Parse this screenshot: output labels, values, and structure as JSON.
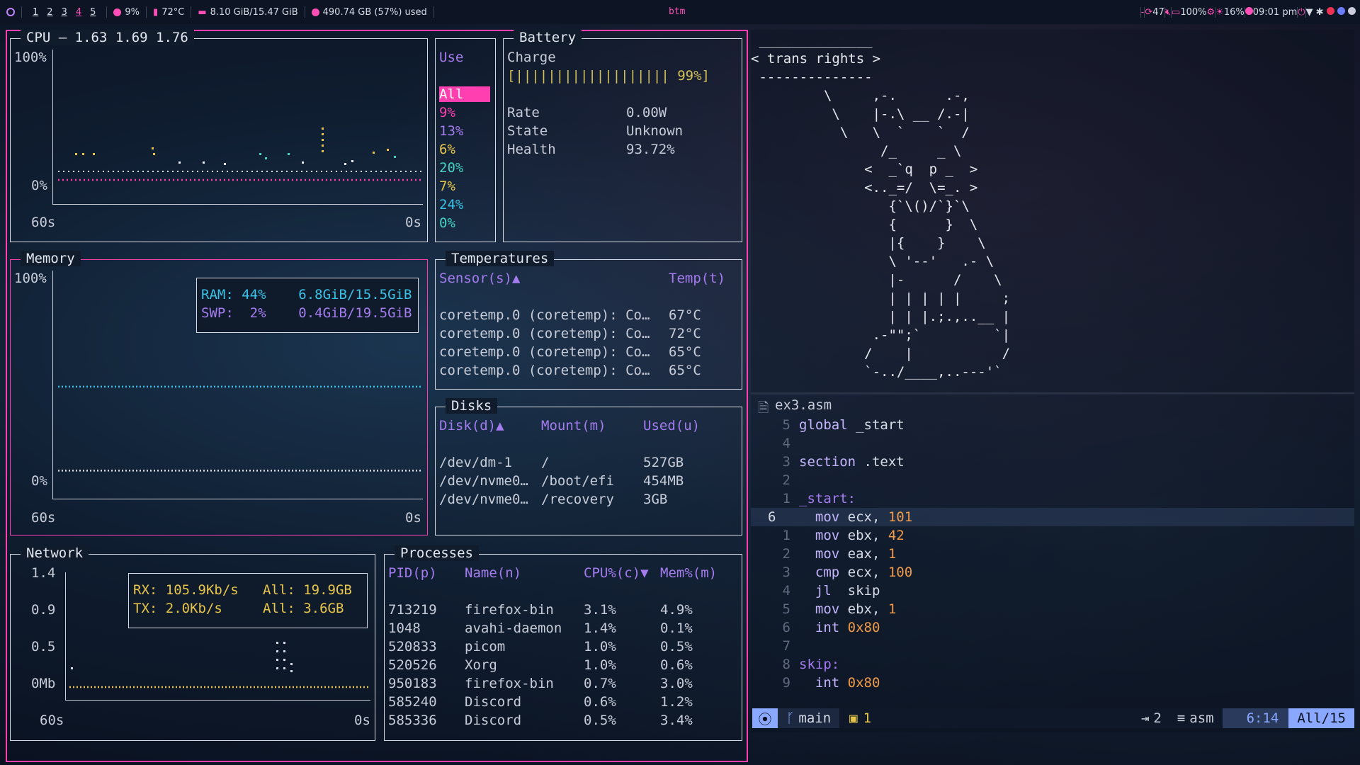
{
  "topbar": {
    "workspaces": [
      "1",
      "2",
      "3",
      "4",
      "5"
    ],
    "active_workspace": "4",
    "cpu": "9%",
    "temp": "72°C",
    "memory": "8.10 GiB/15.47 GiB",
    "disk": "490.74 GB (57%) used",
    "title": "btm",
    "dash": "-",
    "updates": "47",
    "volume": "100%",
    "brightness": "16%",
    "clock": "09:01 pm"
  },
  "cpu": {
    "title": "CPU — 1.63 1.69 1.76",
    "y_max": "100%",
    "y_min": "0%",
    "x_left": "60s",
    "x_right": "0s",
    "use_header": "Use",
    "entries": [
      "All",
      "9%",
      "13%",
      "6%",
      "20%",
      "7%",
      "24%",
      "0%"
    ]
  },
  "battery": {
    "title": "Battery",
    "charge_label": "Charge",
    "bar": "[||||||||||||||||||| 99%]",
    "rate_label": "Rate",
    "rate": "0.00W",
    "state_label": "State",
    "state": "Unknown",
    "health_label": "Health",
    "health": "93.72%"
  },
  "memory": {
    "title": "Memory",
    "y_max": "100%",
    "y_min": "0%",
    "x_left": "60s",
    "x_right": "0s",
    "ram": "RAM: 44%    6.8GiB/15.5GiB",
    "swp": "SWP:  2%    0.4GiB/19.5GiB",
    "ram_fraction": 0.44,
    "swp_fraction": 0.02
  },
  "temperatures": {
    "title": "Temperatures",
    "col_sensor": "Sensor(s)▲",
    "col_temp": "Temp(t)",
    "rows": [
      {
        "sensor": "coretemp.0 (coretemp): Co…",
        "temp": "67°C"
      },
      {
        "sensor": "coretemp.0 (coretemp): Co…",
        "temp": "72°C"
      },
      {
        "sensor": "coretemp.0 (coretemp): Co…",
        "temp": "65°C"
      },
      {
        "sensor": "coretemp.0 (coretemp): Co…",
        "temp": "65°C"
      }
    ]
  },
  "disks": {
    "title": "Disks",
    "col_disk": "Disk(d)▲",
    "col_mount": "Mount(m)",
    "col_used": "Used(u)",
    "rows": [
      {
        "disk": "/dev/dm-1",
        "mount": "/",
        "used": "527GB"
      },
      {
        "disk": "/dev/nvme0…",
        "mount": "/boot/efi",
        "used": "454MB"
      },
      {
        "disk": "/dev/nvme0…",
        "mount": "/recovery",
        "used": "3GB"
      }
    ]
  },
  "network": {
    "title": "Network",
    "y_ticks": [
      "1.4",
      "0.9",
      "0.5",
      "0Mb"
    ],
    "x_left": "60s",
    "x_right": "0s",
    "rx": "RX: 105.9Kb/s   All: 19.9GB",
    "tx": "TX: 2.0Kb/s     All: 3.6GB"
  },
  "processes": {
    "title": "Processes",
    "cols": [
      "PID(p)",
      "Name(n)",
      "CPU%(c)▼",
      "Mem%(m)"
    ],
    "rows": [
      {
        "pid": "713219",
        "name": "firefox-bin",
        "cpu": "3.1%",
        "mem": "4.9%"
      },
      {
        "pid": "1048",
        "name": "avahi-daemon",
        "cpu": "1.4%",
        "mem": "0.1%"
      },
      {
        "pid": "520833",
        "name": "picom",
        "cpu": "1.0%",
        "mem": "0.5%"
      },
      {
        "pid": "520526",
        "name": "Xorg",
        "cpu": "1.0%",
        "mem": "0.6%"
      },
      {
        "pid": "950183",
        "name": "firefox-bin",
        "cpu": "0.7%",
        "mem": "3.0%"
      },
      {
        "pid": "585240",
        "name": "Discord",
        "cpu": "0.6%",
        "mem": "1.2%"
      },
      {
        "pid": "585336",
        "name": "Discord",
        "cpu": "0.5%",
        "mem": "3.4%"
      }
    ]
  },
  "cowsay": {
    "lines": [
      " ______________",
      "< trans rights >",
      " --------------",
      "         \\     ,-.      .-,",
      "          \\    |-.\\ __ /.-|",
      "           \\   \\  `    `  /",
      "                /_     _ \\",
      "              <  _`q  p _  >",
      "              <.._=/  \\=_. >",
      "                 {`\\()/`}`\\",
      "                 {      }  \\",
      "                 |{    }    \\",
      "                 \\ '--'   .- \\",
      "                 |-      /    \\",
      "                 | | | | |     ;",
      "                 | | |.;.,..__ |",
      "               .-\"\";`         `|",
      "              /    |           /",
      "              `-../____,..---'`"
    ]
  },
  "editor": {
    "filename": "ex3.asm",
    "lines": [
      {
        "n": "5",
        "code": "global _start",
        "cur": false
      },
      {
        "n": "4",
        "code": "",
        "cur": false
      },
      {
        "n": "3",
        "code": "section .text",
        "cur": false
      },
      {
        "n": "2",
        "code": "",
        "cur": false
      },
      {
        "n": "1",
        "code": "_start:",
        "cur": false
      },
      {
        "n": "6",
        "code": "  mov ecx, 101",
        "cur": true
      },
      {
        "n": "1",
        "code": "  mov ebx, 42",
        "cur": false
      },
      {
        "n": "2",
        "code": "  mov eax, 1",
        "cur": false
      },
      {
        "n": "3",
        "code": "  cmp ecx, 100",
        "cur": false
      },
      {
        "n": "4",
        "code": "  jl  skip",
        "cur": false
      },
      {
        "n": "5",
        "code": "  mov ebx, 1",
        "cur": false
      },
      {
        "n": "6",
        "code": "  int 0x80",
        "cur": false
      },
      {
        "n": "7",
        "code": "",
        "cur": false
      },
      {
        "n": "8",
        "code": "skip:",
        "cur": false
      },
      {
        "n": "9",
        "code": "  int 0x80",
        "cur": false
      }
    ],
    "status": {
      "branch": "main",
      "diag": "1",
      "indent": "2",
      "filetype": "asm",
      "position": "6:14",
      "scroll": "All/15"
    }
  },
  "colors": {
    "accent": "#ff3fb0",
    "purple": "#a57cf0",
    "cyan": "#39c2e6",
    "yellow": "#e7c54b"
  }
}
